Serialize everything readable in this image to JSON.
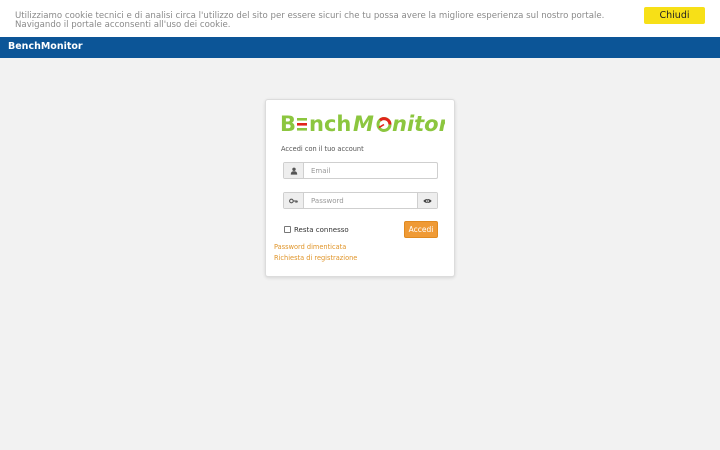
{
  "cookie_bar": {
    "text": "Utilizziamo cookie tecnici e di analisi circa l'utilizzo del sito per essere sicuri che tu possa avere la migliore esperienza sul nostro portale. Navigando il portale acconsenti all'uso dei cookie.",
    "close_label": "Chiudi",
    "button_color": "#f7e017"
  },
  "topbar": {
    "title": "BenchMonitor",
    "color": "#0c5597"
  },
  "login": {
    "logo_text": "BenchMonitor",
    "logo_colors": {
      "green": "#8cc63f",
      "red": "#e2231a"
    },
    "subtitle": "Accedi con il tuo account",
    "email": {
      "value": "",
      "placeholder": "Email",
      "icon": "user-icon"
    },
    "password": {
      "value": "",
      "placeholder": "Password",
      "icon": "key-icon",
      "toggle_icon": "eye-icon"
    },
    "remember_label": "Resta connesso",
    "remember_checked": false,
    "submit_label": "Accedi",
    "submit_color": "#ef9a35",
    "links": {
      "forgot_password": "Password dimenticata",
      "registration": "Richiesta di registrazione"
    },
    "link_color": "#e0952a"
  }
}
